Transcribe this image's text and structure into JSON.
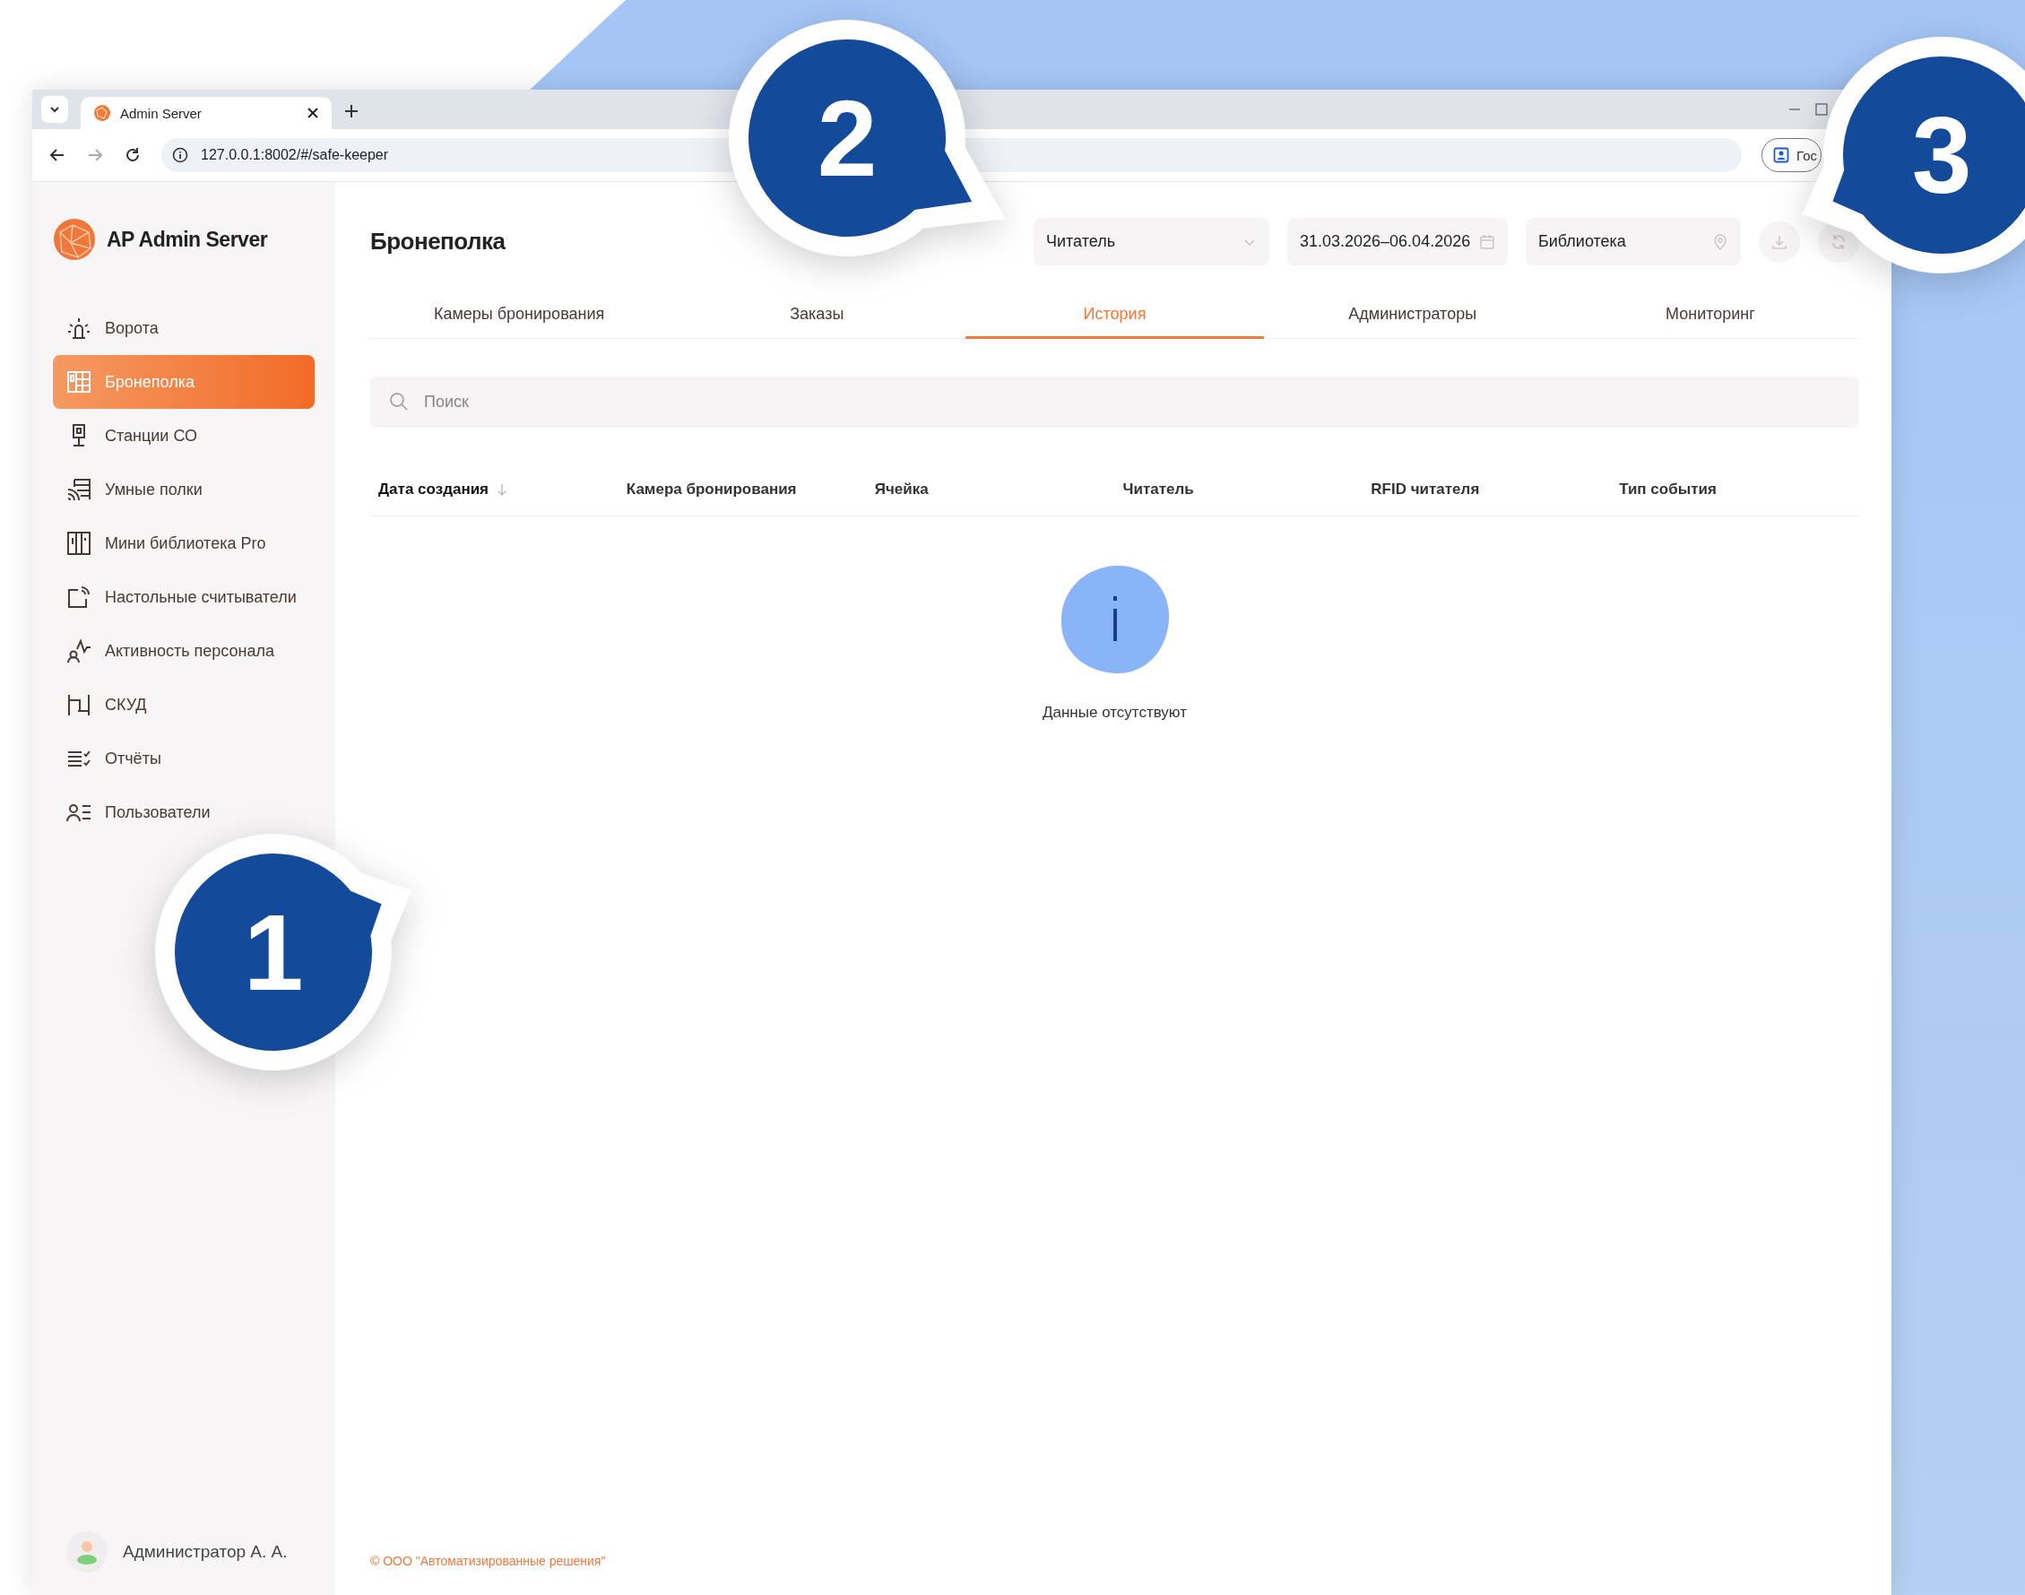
{
  "browser": {
    "tab_title": "Admin Server",
    "url": "127.0.0.1:8002/#/safe-keeper",
    "profile_label": "Гос"
  },
  "sidebar": {
    "app_name": "AP Admin Server",
    "items": [
      {
        "label": "Ворота",
        "kind": "gate",
        "selected": false
      },
      {
        "label": "Бронеполка",
        "kind": "lockers",
        "selected": true
      },
      {
        "label": "Станции СО",
        "kind": "station",
        "selected": false
      },
      {
        "label": "Умные полки",
        "kind": "shelf",
        "selected": false
      },
      {
        "label": "Мини библиотека Pro",
        "kind": "cabinet",
        "selected": false
      },
      {
        "label": "Настольные считыватели",
        "kind": "reader",
        "selected": false
      },
      {
        "label": "Активность персонала",
        "kind": "activity",
        "selected": false
      },
      {
        "label": "СКУД",
        "kind": "turnstile",
        "selected": false
      },
      {
        "label": "Отчёты",
        "kind": "reports",
        "selected": false
      },
      {
        "label": "Пользователи",
        "kind": "users",
        "selected": false
      }
    ],
    "user": {
      "name": "Администратор А. А."
    }
  },
  "page": {
    "title": "Бронеполка",
    "filters": [
      {
        "kind": "select",
        "value": "Читатель"
      },
      {
        "kind": "date-range",
        "value": "31.03.2026–06.04.2026"
      },
      {
        "kind": "location",
        "value": "Библиотека"
      }
    ],
    "tabs": [
      {
        "label": "Камеры бронирования",
        "selected": false
      },
      {
        "label": "Заказы",
        "selected": false
      },
      {
        "label": "История",
        "selected": true
      },
      {
        "label": "Администраторы",
        "selected": false
      },
      {
        "label": "Мониторинг",
        "selected": false
      }
    ],
    "search": {
      "placeholder": "Поиск"
    },
    "table": {
      "columns": [
        {
          "label": "Дата создания",
          "sorted": true
        },
        {
          "label": "Камера бронирования",
          "sorted": false
        },
        {
          "label": "Ячейка",
          "sorted": false
        },
        {
          "label": "Читатель",
          "sorted": false
        },
        {
          "label": "RFID читателя",
          "sorted": false
        },
        {
          "label": "Тип события",
          "sorted": false
        }
      ],
      "empty_text": "Данные отсутствуют"
    },
    "footer": "© ООО \"Автоматизированные решения\""
  },
  "callouts": [
    {
      "number": "1"
    },
    {
      "number": "2"
    },
    {
      "number": "3"
    }
  ]
}
